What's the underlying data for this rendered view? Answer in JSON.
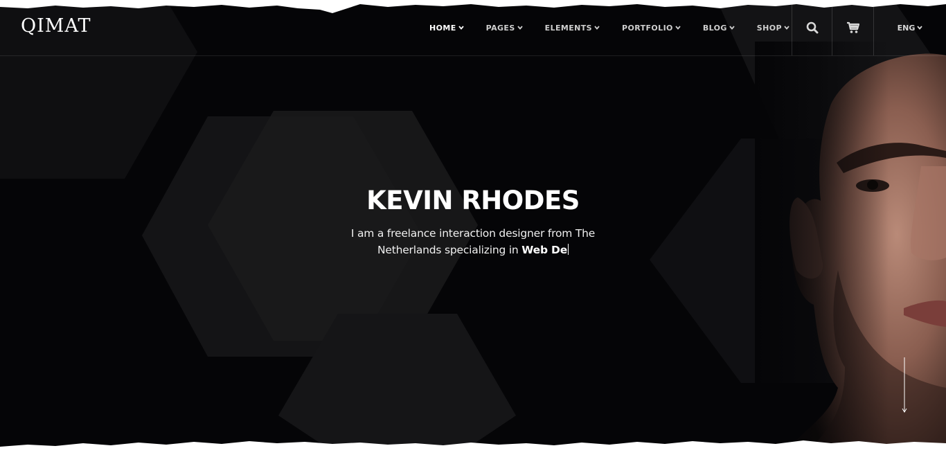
{
  "brand": {
    "logo_text": "QIMAT"
  },
  "nav": {
    "items": [
      {
        "label": "HOME",
        "active": true
      },
      {
        "label": "PAGES",
        "active": false
      },
      {
        "label": "ELEMENTS",
        "active": false
      },
      {
        "label": "PORTFOLIO",
        "active": false
      },
      {
        "label": "BLOG",
        "active": false
      },
      {
        "label": "SHOP",
        "active": false
      }
    ],
    "language": "ENG"
  },
  "icons": {
    "search": "search-icon",
    "cart": "cart-icon",
    "scroll": "scroll-down-arrow-icon",
    "dropdown": "chevron-down-icon"
  },
  "hero": {
    "title": "KEVIN RHODES",
    "subtitle": "I am a freelance interaction designer from The Netherlands specializing in",
    "typed_text": "Web De"
  },
  "colors": {
    "background": "#050507",
    "hexagon": "#1a1a1c",
    "text": "#ffffff",
    "paper": "#ffffff"
  }
}
